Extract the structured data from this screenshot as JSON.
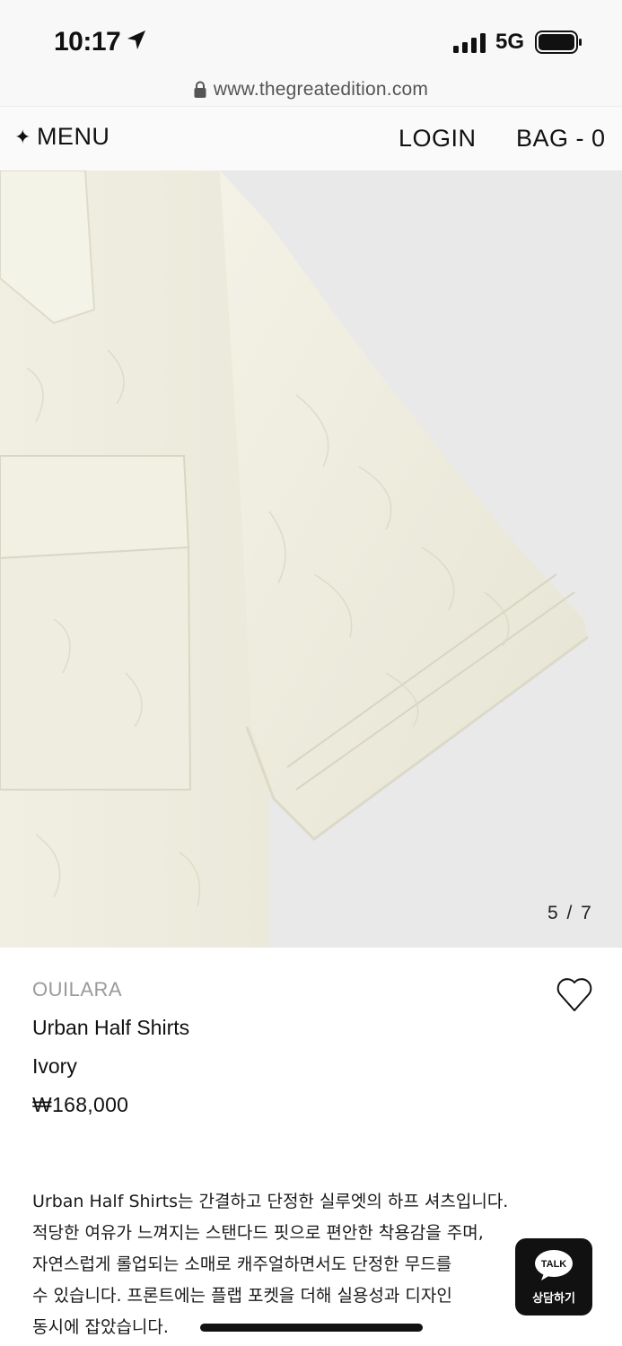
{
  "status_bar": {
    "time": "10:17",
    "network": "5G",
    "icons": [
      "location-arrow-icon",
      "signal-icon",
      "battery-icon"
    ]
  },
  "browser": {
    "url": "www.thegreatedition.com"
  },
  "header": {
    "menu_label": "MENU",
    "menu_icon": "✦",
    "login_label": "LOGIN",
    "bag_label": "BAG - 0"
  },
  "gallery": {
    "counter": "5 / 7",
    "current": 5,
    "total": 7
  },
  "product": {
    "brand": "OUILARA",
    "name": "Urban Half Shirts",
    "color": "Ivory",
    "price": "₩168,000",
    "description": [
      "Urban Half Shirts는 간결하고 단정한 실루엣의 하프 셔츠입니다.",
      "적당한 여유가 느껴지는 스탠다드 핏으로 편안한 착용감을 주며,",
      "자연스럽게 롤업되는 소매로 캐주얼하면서도 단정한 무드를",
      "수 있습니다. 프론트에는 플랩 포켓을 더해 실용성과 디자인",
      "동시에 잡았습니다."
    ]
  },
  "chat_button": {
    "badge": "TALK",
    "label": "상담하기"
  },
  "colors": {
    "image_background": "#e9e9e9",
    "shirt": "#f3f1e4",
    "text": "#111111",
    "muted": "#9a9a9a"
  }
}
